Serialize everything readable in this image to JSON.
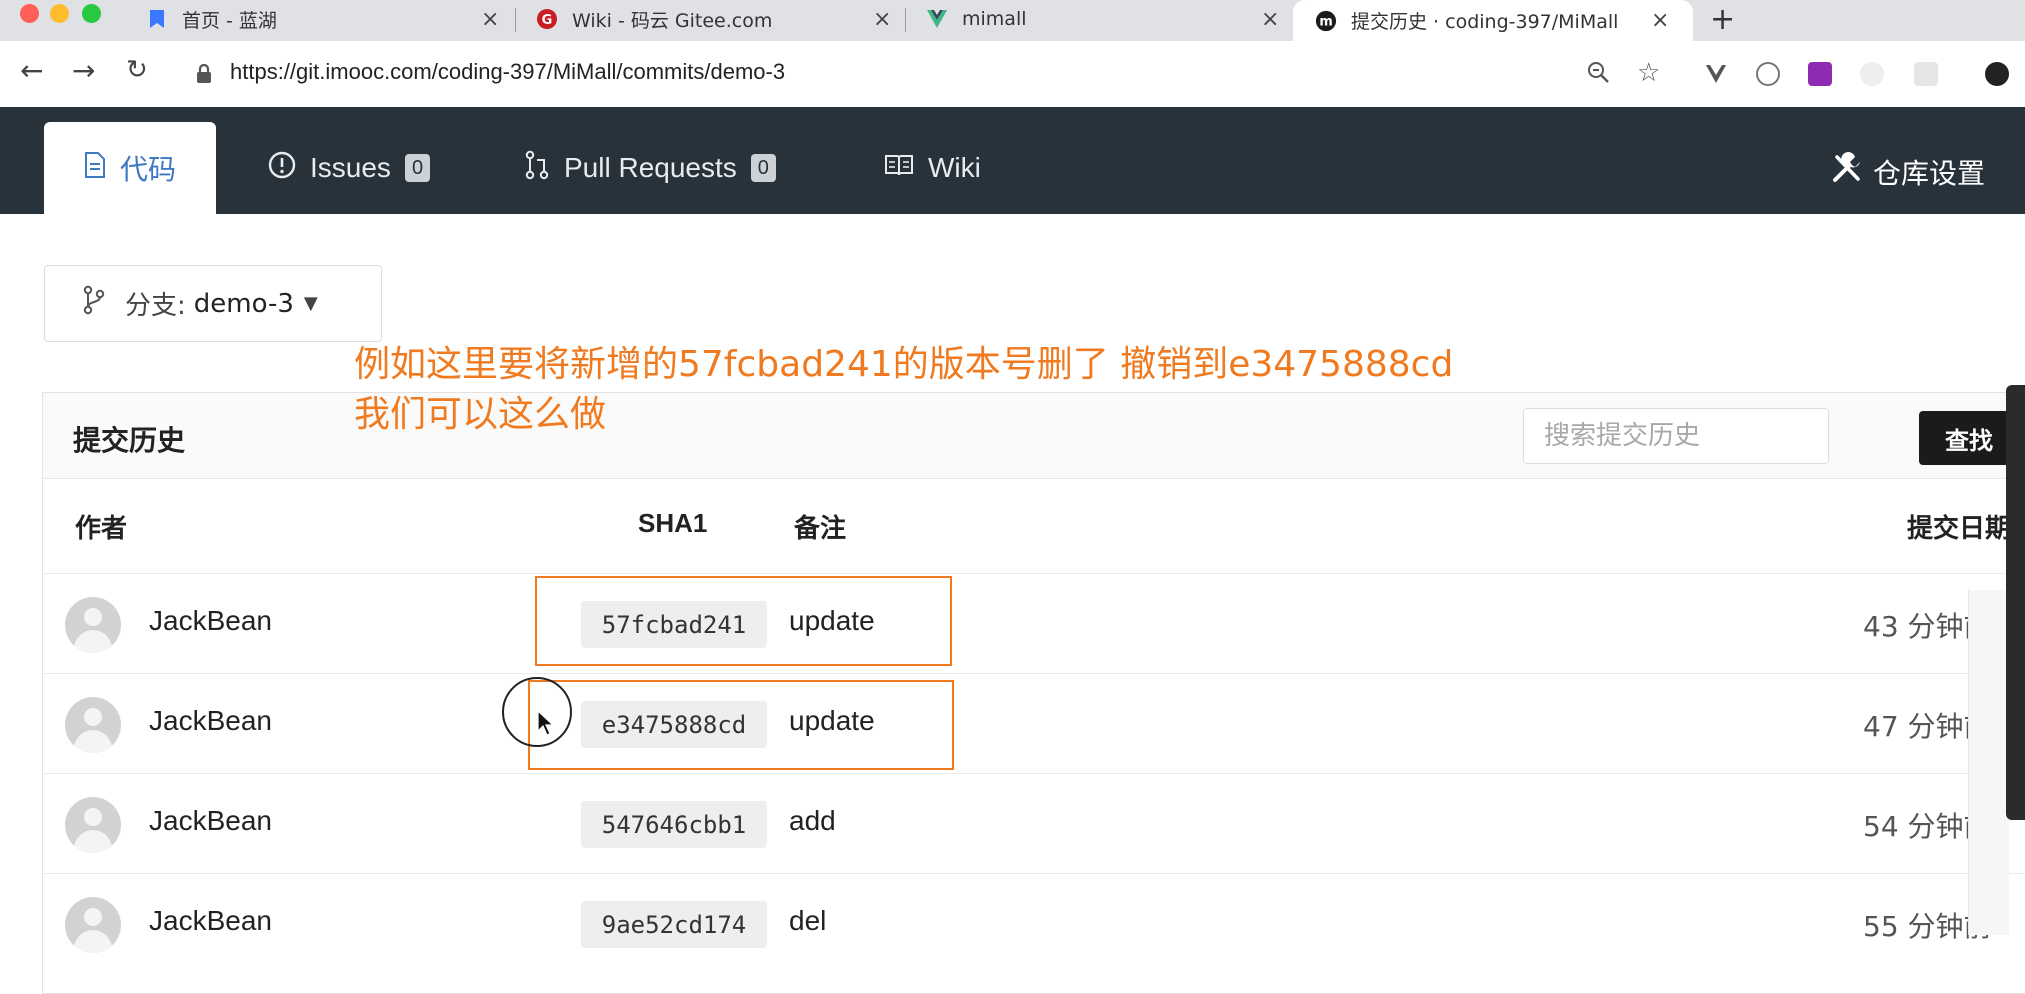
{
  "browser": {
    "tabs": [
      {
        "title": "首页 - 蓝湖",
        "favicon": "lanhu-icon",
        "active": false
      },
      {
        "title": "Wiki - 码云 Gitee.com",
        "favicon": "gitee-icon",
        "active": false
      },
      {
        "title": "mimall",
        "favicon": "vue-icon",
        "active": false
      },
      {
        "title": "提交历史 · coding-397/MiMall",
        "favicon": "imooc-icon",
        "active": true
      }
    ],
    "close_glyph": "×",
    "new_tab_glyph": "+",
    "url": "https://git.imooc.com/coding-397/MiMall/commits/demo-3"
  },
  "repo_nav": {
    "tabs": [
      {
        "label": "代码",
        "icon": "file-icon",
        "badge": null,
        "active": true
      },
      {
        "label": "Issues",
        "icon": "exclamation-icon",
        "badge": "0",
        "active": false
      },
      {
        "label": "Pull Requests",
        "icon": "pull-request-icon",
        "badge": "0",
        "active": false
      },
      {
        "label": "Wiki",
        "icon": "book-icon",
        "badge": null,
        "active": false
      }
    ],
    "settings_label": "仓库设置"
  },
  "branch": {
    "prefix": "分支:",
    "name": "demo-3"
  },
  "annotation": {
    "line1": "例如这里要将新增的57fcbad241的版本号删了 撤销到e3475888cd",
    "line2": "我们可以这么做"
  },
  "commits": {
    "title": "提交历史",
    "search_placeholder": "搜索提交历史",
    "search_button": "查找",
    "columns": {
      "author": "作者",
      "sha": "SHA1",
      "message": "备注",
      "date": "提交日期"
    },
    "rows": [
      {
        "author": "JackBean",
        "sha": "57fcbad241",
        "message": "update",
        "date": "43 分钟前"
      },
      {
        "author": "JackBean",
        "sha": "e3475888cd",
        "message": "update",
        "date": "47 分钟前"
      },
      {
        "author": "JackBean",
        "sha": "547646cbb1",
        "message": "add",
        "date": "54 分钟前"
      },
      {
        "author": "JackBean",
        "sha": "9ae52cd174",
        "message": "del",
        "date": "55 分钟前"
      }
    ]
  },
  "colors": {
    "annotation": "#f07a1f",
    "nav_bg": "#28323a",
    "active_tab_text": "#3f79c2"
  }
}
